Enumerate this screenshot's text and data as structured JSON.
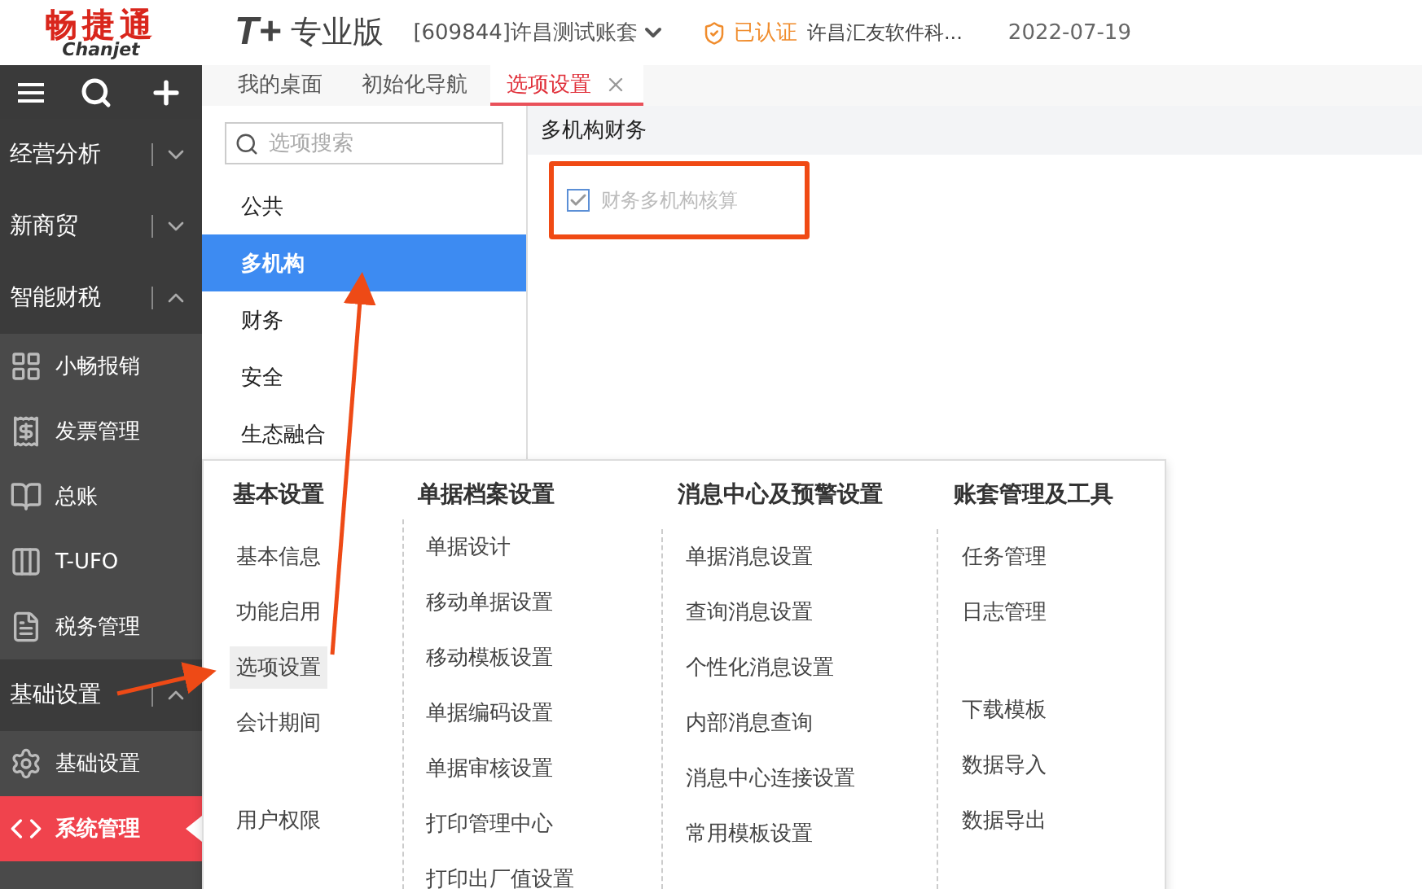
{
  "header": {
    "logo": "畅捷通",
    "logo_sub": "Chanjet",
    "product": "T+",
    "edition": "专业版",
    "account": "[609844]许昌测试账套",
    "verified": "已认证",
    "company": "许昌汇友软件科...",
    "date": "2022-07-19"
  },
  "sidebar": {
    "items": [
      {
        "kind": "group",
        "label": "经营分析",
        "expanded": false
      },
      {
        "kind": "group",
        "label": "新商贸",
        "expanded": false
      },
      {
        "kind": "group",
        "label": "智能财税",
        "expanded": true
      },
      {
        "kind": "item",
        "label": "小畅报销",
        "selected": false
      },
      {
        "kind": "item",
        "label": "发票管理",
        "selected": false
      },
      {
        "kind": "item",
        "label": "总账",
        "selected": false
      },
      {
        "kind": "item",
        "label": "T-UFO",
        "selected": false
      },
      {
        "kind": "item",
        "label": "税务管理",
        "selected": false
      },
      {
        "kind": "group",
        "label": "基础设置",
        "expanded": true
      },
      {
        "kind": "item",
        "label": "基础设置",
        "selected": false
      },
      {
        "kind": "item",
        "label": "系统管理",
        "selected": true
      }
    ]
  },
  "tabs": [
    {
      "label": "我的桌面",
      "selected": false
    },
    {
      "label": "初始化导航",
      "selected": false
    },
    {
      "label": "选项设置",
      "selected": true
    }
  ],
  "options": {
    "search_placeholder": "选项搜索",
    "categories": [
      {
        "label": "公共",
        "selected": false
      },
      {
        "label": "多机构",
        "selected": true
      },
      {
        "label": "财务",
        "selected": false
      },
      {
        "label": "安全",
        "selected": false
      },
      {
        "label": "生态融合",
        "selected": false
      }
    ]
  },
  "content": {
    "section": "多机构财务",
    "checkbox": {
      "label": "财务多机构核算",
      "checked": true,
      "disabled": true
    }
  },
  "menu": {
    "columns": [
      {
        "title": "基本设置",
        "sections": [
          [
            {
              "label": "基本信息",
              "selected": false
            },
            {
              "label": "功能启用",
              "selected": false
            },
            {
              "label": "选项设置",
              "selected": true
            },
            {
              "label": "会计期间",
              "selected": false
            }
          ],
          [
            {
              "label": "用户权限",
              "selected": false
            }
          ]
        ]
      },
      {
        "title": "单据档案设置",
        "sections": [
          [
            {
              "label": "单据设计",
              "selected": false
            },
            {
              "label": "移动单据设置",
              "selected": false
            },
            {
              "label": "移动模板设置",
              "selected": false
            },
            {
              "label": "单据编码设置",
              "selected": false
            },
            {
              "label": "单据审核设置",
              "selected": false
            },
            {
              "label": "打印管理中心",
              "selected": false
            },
            {
              "label": "打印出厂值设置",
              "selected": false
            }
          ]
        ]
      },
      {
        "title": "消息中心及预警设置",
        "sections": [
          [
            {
              "label": "单据消息设置",
              "selected": false
            },
            {
              "label": "查询消息设置",
              "selected": false
            },
            {
              "label": "个性化消息设置",
              "selected": false
            },
            {
              "label": "内部消息查询",
              "selected": false
            },
            {
              "label": "消息中心连接设置",
              "selected": false
            },
            {
              "label": "常用模板设置",
              "selected": false
            }
          ]
        ]
      },
      {
        "title": "账套管理及工具",
        "sections": [
          [
            {
              "label": "任务管理",
              "selected": false
            },
            {
              "label": "日志管理",
              "selected": false
            }
          ],
          [
            {
              "label": "下载模板",
              "selected": false
            },
            {
              "label": "数据导入",
              "selected": false
            },
            {
              "label": "数据导出",
              "selected": false
            }
          ]
        ]
      }
    ]
  }
}
